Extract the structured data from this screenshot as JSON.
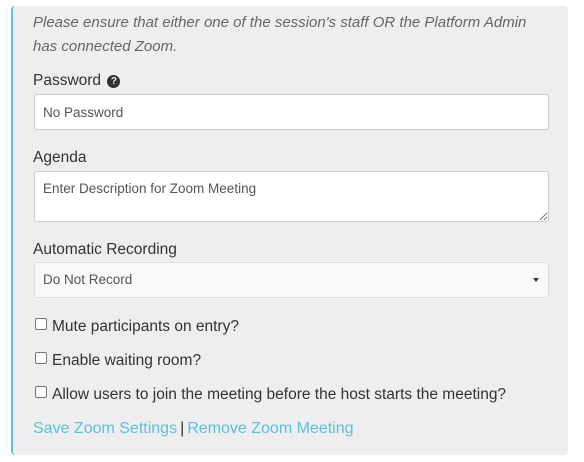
{
  "notice": {
    "text": "Please ensure that either one of the session's staff OR the Platform Admin has connected Zoom."
  },
  "password": {
    "label": "Password",
    "placeholder": "No Password",
    "value": ""
  },
  "agenda": {
    "label": "Agenda",
    "placeholder": "Enter Description for Zoom Meeting",
    "value": ""
  },
  "recording": {
    "label": "Automatic Recording",
    "selected": "Do Not Record"
  },
  "options": [
    {
      "label": "Mute participants on entry?",
      "checked": false
    },
    {
      "label": "Enable waiting room?",
      "checked": false
    },
    {
      "label": "Allow users to join the meeting before the host starts the meeting?",
      "checked": false
    }
  ],
  "actions": {
    "save_label": "Save Zoom Settings",
    "separator": "|",
    "remove_label": "Remove Zoom Meeting"
  },
  "colors": {
    "accent": "#5bc0de",
    "panel_bg": "#eeeeee"
  },
  "icons": {
    "password_help": "question-circle-icon",
    "recording_dropdown": "caret-down-icon"
  }
}
